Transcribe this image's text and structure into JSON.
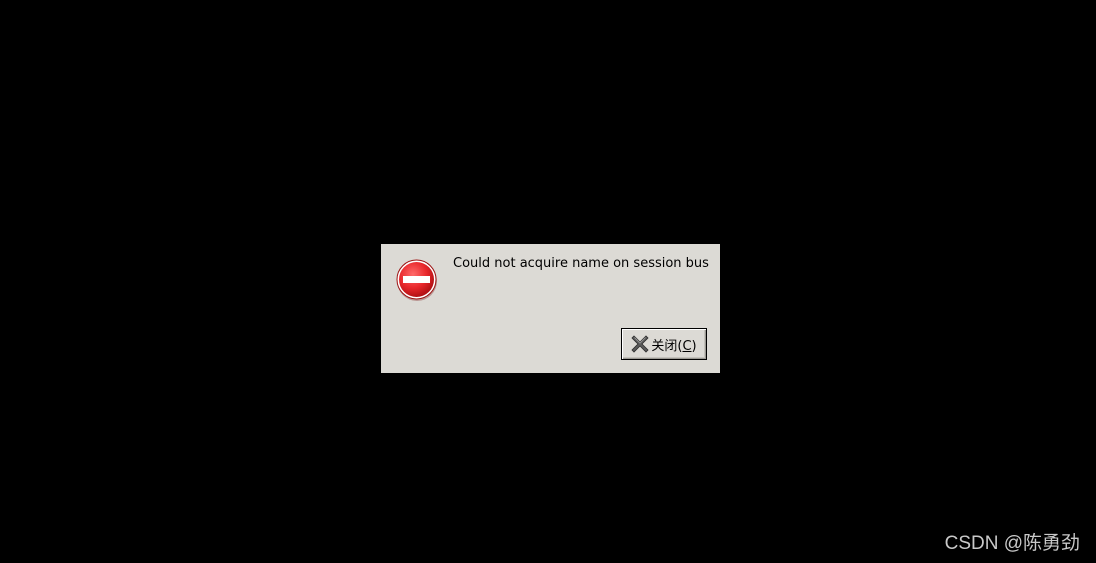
{
  "dialog": {
    "message": "Could not acquire name on session bus",
    "icon": "error-stop-icon",
    "close_button": {
      "label_text": "关闭(",
      "mnemonic": "C",
      "label_end": ")",
      "icon": "close-x-icon"
    }
  },
  "watermark": "CSDN @陈勇劲",
  "colors": {
    "desktop_bg": "#000000",
    "dialog_bg": "#dcdad5",
    "error_red": "#e8272b"
  }
}
